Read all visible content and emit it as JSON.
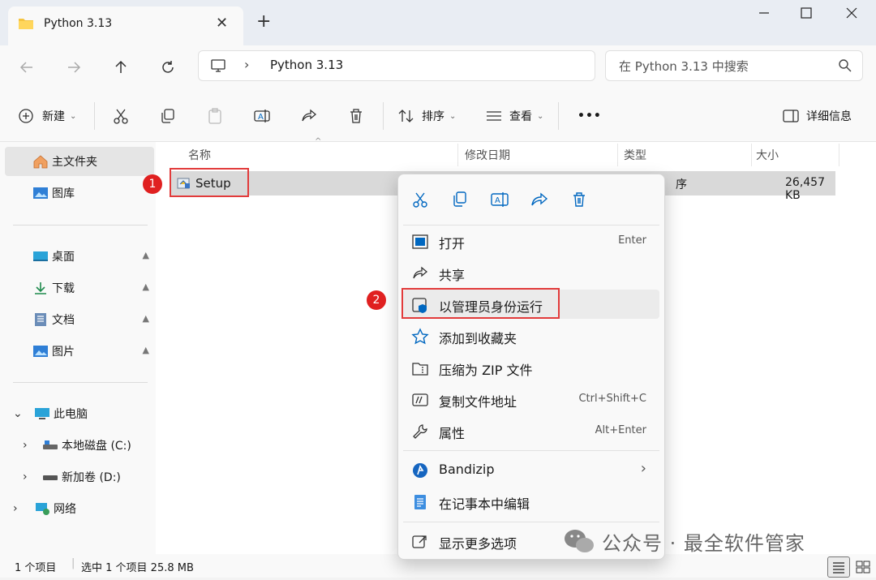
{
  "window": {
    "tab_title": "Python 3.13",
    "tab_close": "✕",
    "new_tab": "+"
  },
  "nav": {
    "address_chevron": "›",
    "address_path": "Python 3.13",
    "search_placeholder": "在 Python 3.13 中搜索"
  },
  "toolbar": {
    "new_label": "新建",
    "sort_label": "排序",
    "view_label": "查看",
    "more_label": "•••",
    "details_label": "详细信息",
    "caret": "⌄"
  },
  "sidebar": {
    "home": "主文件夹",
    "gallery": "图库",
    "quick": [
      {
        "label": "桌面",
        "icon": "desktop-icon"
      },
      {
        "label": "下载",
        "icon": "download-icon"
      },
      {
        "label": "文档",
        "icon": "document-icon"
      },
      {
        "label": "图片",
        "icon": "pictures-icon"
      }
    ],
    "pin_glyph": "📌",
    "this_pc": "此电脑",
    "drive_c": "本地磁盘 (C:)",
    "drive_d": "新加卷 (D:)",
    "network": "网络",
    "expand_glyph": "›",
    "collapse_glyph": "⌄"
  },
  "columns": {
    "name": "名称",
    "modified": "修改日期",
    "type": "类型",
    "size": "大小"
  },
  "file": {
    "name": "Setup",
    "type_partial": "序",
    "size": "26,457 KB"
  },
  "badges": {
    "one": "1",
    "two": "2"
  },
  "context_menu": {
    "items": [
      {
        "label": "打开",
        "shortcut": "Enter",
        "icon": "open-icon"
      },
      {
        "label": "共享",
        "shortcut": "",
        "icon": "share-icon"
      },
      {
        "label": "以管理员身份运行",
        "shortcut": "",
        "icon": "admin-shield-icon"
      },
      {
        "label": "添加到收藏夹",
        "shortcut": "",
        "icon": "star-icon"
      },
      {
        "label": "压缩为 ZIP 文件",
        "shortcut": "",
        "icon": "zip-icon"
      },
      {
        "label": "复制文件地址",
        "shortcut": "Ctrl+Shift+C",
        "icon": "copy-path-icon"
      },
      {
        "label": "属性",
        "shortcut": "Alt+Enter",
        "icon": "wrench-icon"
      },
      {
        "label": "Bandizip",
        "shortcut": "",
        "icon": "bandizip-icon"
      },
      {
        "label": "在记事本中编辑",
        "shortcut": "",
        "icon": "notepad-icon"
      },
      {
        "label": "显示更多选项",
        "shortcut": "",
        "icon": "more-options-icon"
      }
    ],
    "submenu_arrow": "›"
  },
  "status": {
    "count": "1 个项目",
    "selected": "选中 1 个项目  25.8 MB"
  },
  "watermark": "公众号 · 最全软件管家",
  "colors": {
    "accent": "#0067c0",
    "highlight": "#e23b3b",
    "selection": "#d9d9d9"
  }
}
